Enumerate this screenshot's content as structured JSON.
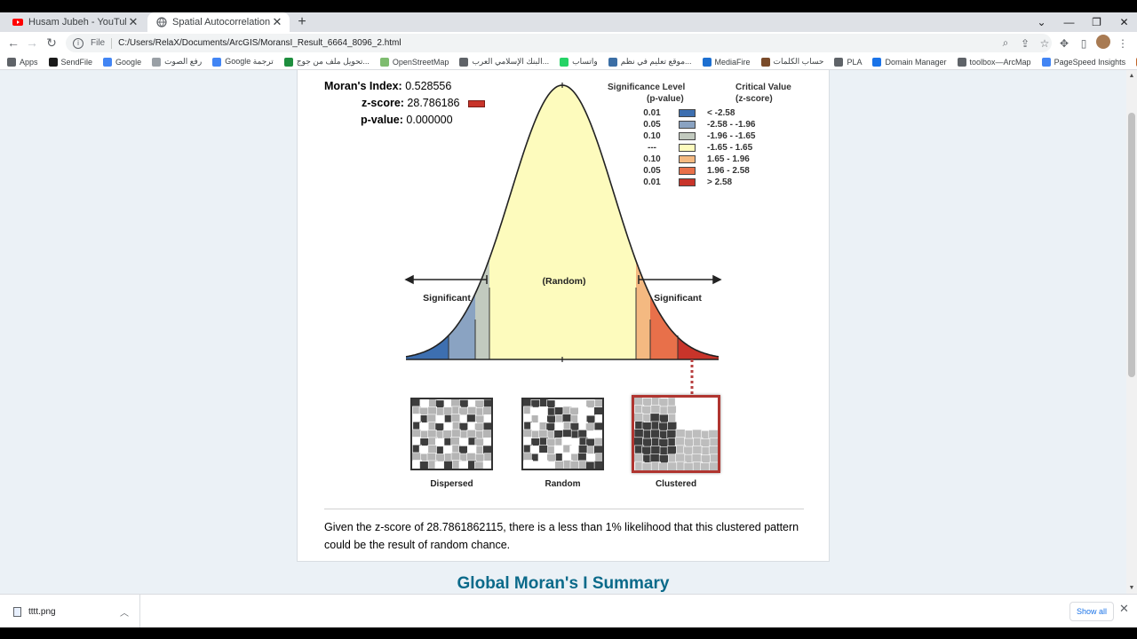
{
  "browser": {
    "tabs": [
      {
        "label": "Husam Jubeh - YouTube",
        "active": false
      },
      {
        "label": "Spatial Autocorrelation Report",
        "active": true
      }
    ],
    "url_scheme": "File",
    "url_path": "C:/Users/RelaX/Documents/ArcGIS/MoransI_Result_6664_8096_2.html",
    "bookmarks": [
      {
        "label": "Apps",
        "icon": "apps-grid-icon",
        "color": "#5f6368"
      },
      {
        "label": "SendFile",
        "icon": "sendfile-icon",
        "color": "#1a1a1a"
      },
      {
        "label": "Google",
        "icon": "google-icon",
        "color": "#4285f4"
      },
      {
        "label": "رفع الصوت",
        "icon": "audio-icon",
        "color": "#9aa0a6"
      },
      {
        "label": "Google ترجمة",
        "icon": "translate-icon",
        "color": "#4285f4"
      },
      {
        "label": "تحويل ملف من جوج...",
        "icon": "convert-icon",
        "color": "#1e8e3e"
      },
      {
        "label": "OpenStreetMap",
        "icon": "osm-icon",
        "color": "#7ebc6f"
      },
      {
        "label": "البنك الإسلامي العرب...",
        "icon": "globe-icon",
        "color": "#5f6368"
      },
      {
        "label": "واتساب",
        "icon": "whatsapp-icon",
        "color": "#25d366"
      },
      {
        "label": "موقع تعليم في نظم...",
        "icon": "globe-icon",
        "color": "#3b6ea5"
      },
      {
        "label": "MediaFire",
        "icon": "mediafire-icon",
        "color": "#1c6fd1"
      },
      {
        "label": "حساب الكلمات",
        "icon": "counter-icon",
        "color": "#7a4b2a"
      },
      {
        "label": "PLA",
        "icon": "pla-icon",
        "color": "#5f6368"
      },
      {
        "label": "Domain Manager",
        "icon": "domain-icon",
        "color": "#1a73e8"
      },
      {
        "label": "toolbox—ArcMap",
        "icon": "globe-icon",
        "color": "#5f6368"
      },
      {
        "label": "PageSpeed Insights",
        "icon": "pagespeed-icon",
        "color": "#4285f4"
      },
      {
        "label": "Squoosh",
        "icon": "squoosh-icon",
        "color": "#c0642a"
      }
    ]
  },
  "report": {
    "stats": {
      "morans_label": "Moran's Index:",
      "morans_value": "0.528556",
      "z_label": "z-score:",
      "z_value": "28.786186",
      "p_label": "p-value:",
      "p_value": "0.000000"
    },
    "legend": {
      "header_sig": "Significance Level",
      "header_sig_sub": "(p-value)",
      "header_crit": "Critical Value",
      "header_crit_sub": "(z-score)",
      "rows": [
        {
          "p": "0.01",
          "z": "< -2.58",
          "color": "#3d6fb0"
        },
        {
          "p": "0.05",
          "z": "-2.58 - -1.96",
          "color": "#8aa3c2"
        },
        {
          "p": "0.10",
          "z": "-1.96 - -1.65",
          "color": "#c2cabf"
        },
        {
          "p": "---",
          "z": "-1.65 - 1.65",
          "color": "#fdfbbd"
        },
        {
          "p": "0.10",
          "z": "1.65 - 1.96",
          "color": "#f4b981"
        },
        {
          "p": "0.05",
          "z": "1.96 - 2.58",
          "color": "#e8704a"
        },
        {
          "p": "0.01",
          "z": "> 2.58",
          "color": "#c8342a"
        }
      ]
    },
    "curve_labels": {
      "random": "(Random)",
      "sig_left": "Significant",
      "sig_right": "Significant"
    },
    "maps": [
      {
        "label": "Dispersed"
      },
      {
        "label": "Random"
      },
      {
        "label": "Clustered",
        "highlighted": true
      }
    ],
    "conclusion": "Given the z-score of 28.7861862115, there is a less than 1% likelihood that this clustered pattern could be the result of random chance.",
    "summary_title": "Global Moran's I Summary"
  },
  "downloads": {
    "file": "tttt.png",
    "show_all": "Show all"
  }
}
